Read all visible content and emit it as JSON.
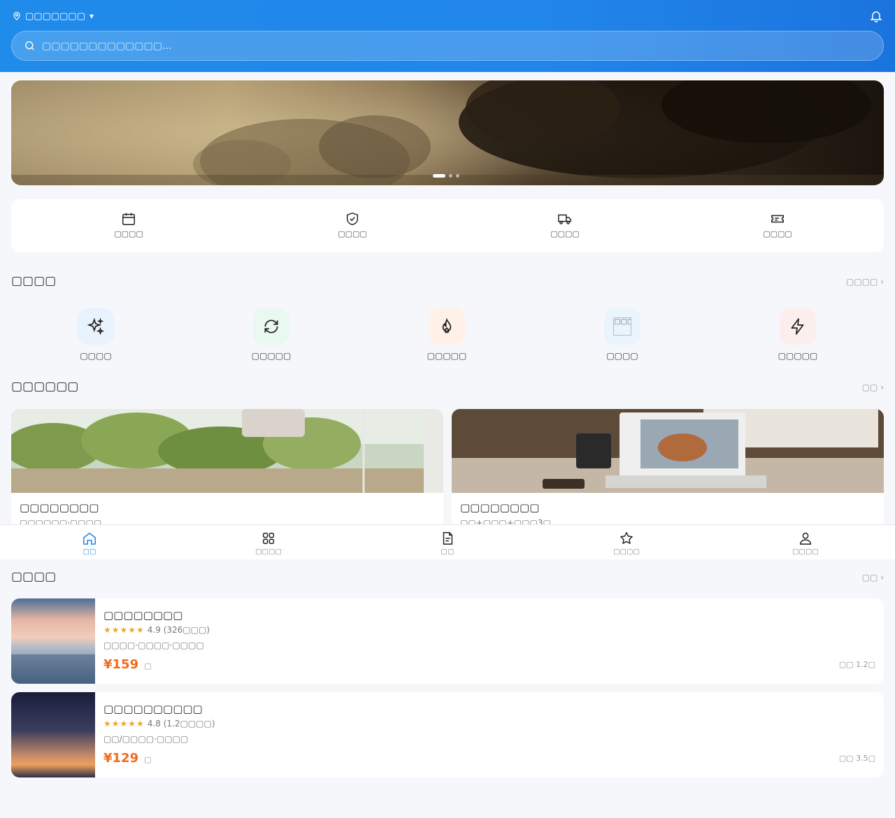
{
  "header": {
    "location": "▢▢▢▢▢▢▢",
    "location_caret": "▾",
    "search_placeholder": "▢▢▢▢▢▢▢▢▢▢▢▢▢..."
  },
  "banner": {
    "slides": 3,
    "active_slide": 1
  },
  "features": [
    {
      "label": "▢▢▢▢",
      "icon": "calendar-icon"
    },
    {
      "label": "▢▢▢▢",
      "icon": "shield-check-icon"
    },
    {
      "label": "▢▢▢▢",
      "icon": "truck-icon"
    },
    {
      "label": "▢▢▢▢",
      "icon": "ticket-icon"
    }
  ],
  "categories_section": {
    "title": "▢▢▢▢",
    "more": "▢▢▢▢ ›",
    "items": [
      {
        "label": "▢▢▢▢",
        "icon": "sparkle-icon",
        "bg": "#e9f3fe"
      },
      {
        "label": "▢▢▢▢▢",
        "icon": "refresh-icon",
        "bg": "#e9f9ef"
      },
      {
        "label": "▢▢▢▢▢",
        "icon": "flame-icon",
        "bg": "#fff1e8"
      },
      {
        "label": "▢▢▢▢",
        "icon": "broken-image-icon",
        "bg": "#eaf4fd",
        "broken_alt": "▢▢▢▢"
      },
      {
        "label": "▢▢▢▢▢",
        "icon": "lightning-icon",
        "bg": "#fdeeee"
      }
    ]
  },
  "packages_section": {
    "title": "▢▢▢▢▢▢",
    "more": "▢▢ ›",
    "items": [
      {
        "title": "▢▢▢▢▢▢▢▢",
        "subtitle": "▢▢▢▢▢▢·▢▢▢▢"
      },
      {
        "title": "▢▢▢▢▢▢▢▢",
        "subtitle": "▢▢+▢▢▢+▢▢▢3▢"
      }
    ]
  },
  "tabbar": {
    "items": [
      {
        "label": "▢▢",
        "icon": "home-icon",
        "active": true
      },
      {
        "label": "▢▢▢▢",
        "icon": "grid-icon",
        "active": false
      },
      {
        "label": "▢▢",
        "icon": "document-icon",
        "active": false
      },
      {
        "label": "▢▢▢▢",
        "icon": "star-icon",
        "active": false
      },
      {
        "label": "▢▢▢▢",
        "icon": "user-icon",
        "active": false
      }
    ]
  },
  "shops_section": {
    "title": "▢▢▢▢",
    "more": "▢▢ ›",
    "items": [
      {
        "name": "▢▢▢▢▢▢▢▢",
        "stars": "★★★★★",
        "rating": "4.9 (326▢▢▢)",
        "tags": "▢▢▢▢·▢▢▢▢·▢▢▢▢",
        "price": "¥159",
        "unit": "▢",
        "distance": "▢▢ 1.2▢"
      },
      {
        "name": "▢▢▢▢▢▢▢▢▢▢",
        "stars": "★★★★★",
        "rating": "4.8 (1.2▢▢▢▢)",
        "tags": "▢▢/▢▢▢▢·▢▢▢▢",
        "price": "¥129",
        "unit": "▢",
        "distance": "▢▢ 3.5▢"
      }
    ]
  },
  "colors": {
    "accent": "#1e88e5",
    "price": "#f26b1d",
    "star": "#f5a623",
    "page_bg": "#f5f7fa"
  }
}
